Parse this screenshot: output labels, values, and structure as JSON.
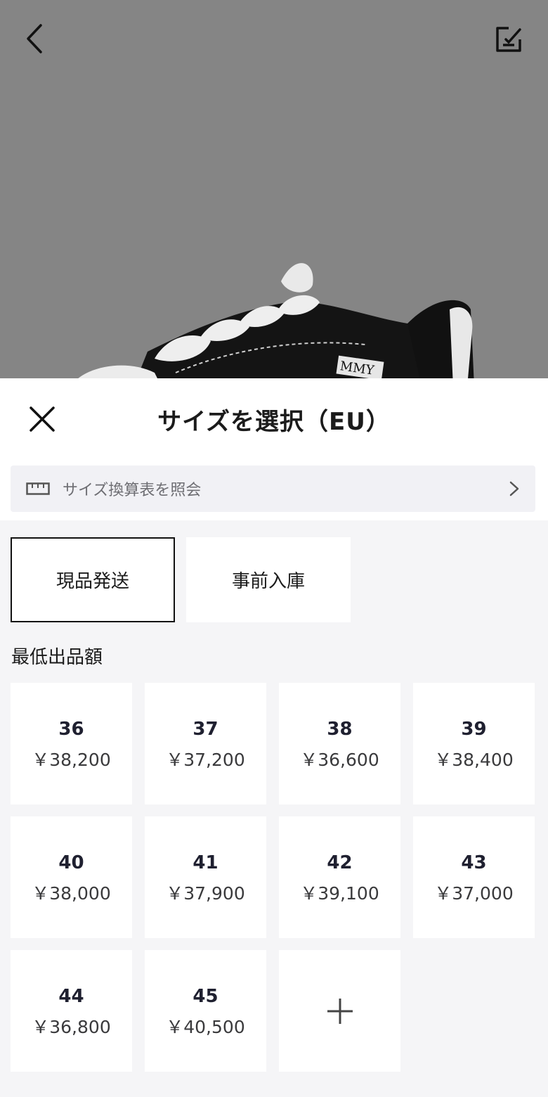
{
  "background": {
    "back_icon": "chevron-left-icon",
    "edit_icon": "edit-note-icon",
    "logo_partial": "MMY"
  },
  "sheet": {
    "title": "サイズを選択（EU）",
    "close_icon": "close-icon",
    "conversion_link": {
      "icon": "ruler-icon",
      "label": "サイズ換算表を照会",
      "chevron": "chevron-right-icon"
    },
    "tabs": [
      {
        "label": "現品発送",
        "active": true
      },
      {
        "label": "事前入庫",
        "active": false
      }
    ],
    "section_label": "最低出品額",
    "sizes": [
      {
        "size": "36",
        "price": "￥38,200"
      },
      {
        "size": "37",
        "price": "￥37,200"
      },
      {
        "size": "38",
        "price": "￥36,600"
      },
      {
        "size": "39",
        "price": "￥38,400"
      },
      {
        "size": "40",
        "price": "￥38,000"
      },
      {
        "size": "41",
        "price": "￥37,900"
      },
      {
        "size": "42",
        "price": "￥39,100"
      },
      {
        "size": "43",
        "price": "￥37,000"
      },
      {
        "size": "44",
        "price": "￥36,800"
      },
      {
        "size": "45",
        "price": "￥40,500"
      }
    ],
    "more_icon": "plus-icon"
  },
  "colors": {
    "backdrop": "#858585",
    "sheet_bg": "#f5f5f7",
    "card_bg": "#ffffff",
    "active_border": "#111111"
  }
}
